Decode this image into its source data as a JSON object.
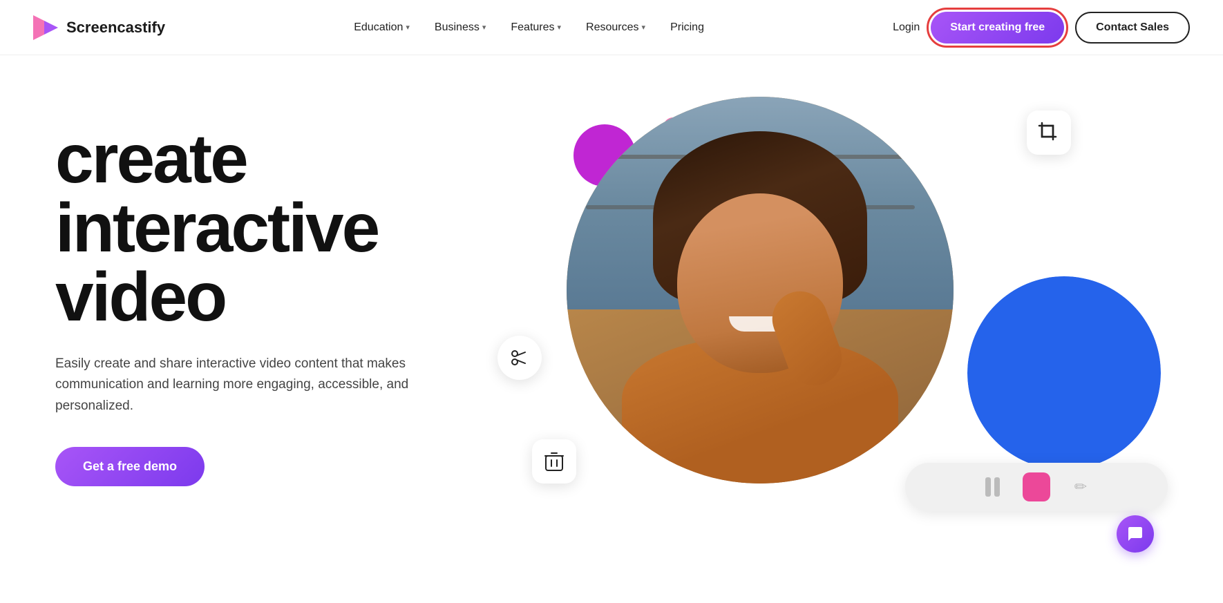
{
  "nav": {
    "logo_text_screen": "Screen",
    "logo_text_castify": "castify",
    "links": [
      {
        "label": "Education",
        "has_dropdown": true
      },
      {
        "label": "Business",
        "has_dropdown": true
      },
      {
        "label": "Features",
        "has_dropdown": true
      },
      {
        "label": "Resources",
        "has_dropdown": true
      },
      {
        "label": "Pricing",
        "has_dropdown": false
      }
    ],
    "login_label": "Login",
    "start_label": "Start creating free",
    "contact_label": "Contact Sales"
  },
  "hero": {
    "heading_line1": "create",
    "heading_line2": "interactive",
    "heading_line3": "video",
    "subtext": "Easily create and share interactive video content that makes communication and learning more engaging, accessible, and personalized.",
    "cta_label": "Get a free demo"
  },
  "icons": {
    "crop": "⌗",
    "scissors": "✂",
    "trash": "🗑",
    "chat": "💬"
  },
  "colors": {
    "purple_main": "#7c3aed",
    "purple_gradient_start": "#a855f7",
    "blue_accent": "#2563eb",
    "pink_accent": "#ec4899",
    "red_outline": "#e53e3e"
  }
}
